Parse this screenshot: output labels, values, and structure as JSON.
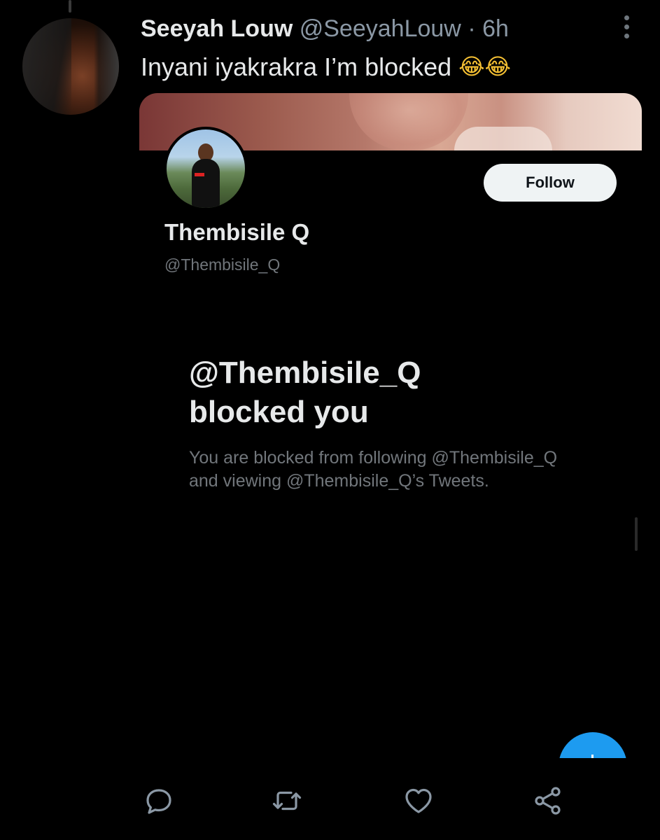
{
  "tweet": {
    "author_name": "Seeyah Louw",
    "author_handle": "@SeeyahLouw",
    "separator": "·",
    "time": "6h",
    "text": "Inyani iyakrakra I’m blocked",
    "emoji": "😂😂"
  },
  "embedded_profile": {
    "follow_label": "Follow",
    "display_name": "Thembisile Q",
    "handle": "@Thembisile_Q",
    "blocked_title_line1": "@Thembisile_Q",
    "blocked_title_line2": "blocked you",
    "blocked_desc_line1": "You are blocked from following @Thembisile_Q",
    "blocked_desc_line2": "and viewing @Thembisile_Q’s Tweets."
  },
  "actions": {
    "reply_icon": "reply-icon",
    "retweet_icon": "retweet-icon",
    "like_icon": "heart-icon",
    "share_icon": "share-icon"
  },
  "colors": {
    "background": "#000000",
    "text_primary": "#e7e9ea",
    "text_secondary": "#8b98a5",
    "accent": "#1d9bf0"
  }
}
